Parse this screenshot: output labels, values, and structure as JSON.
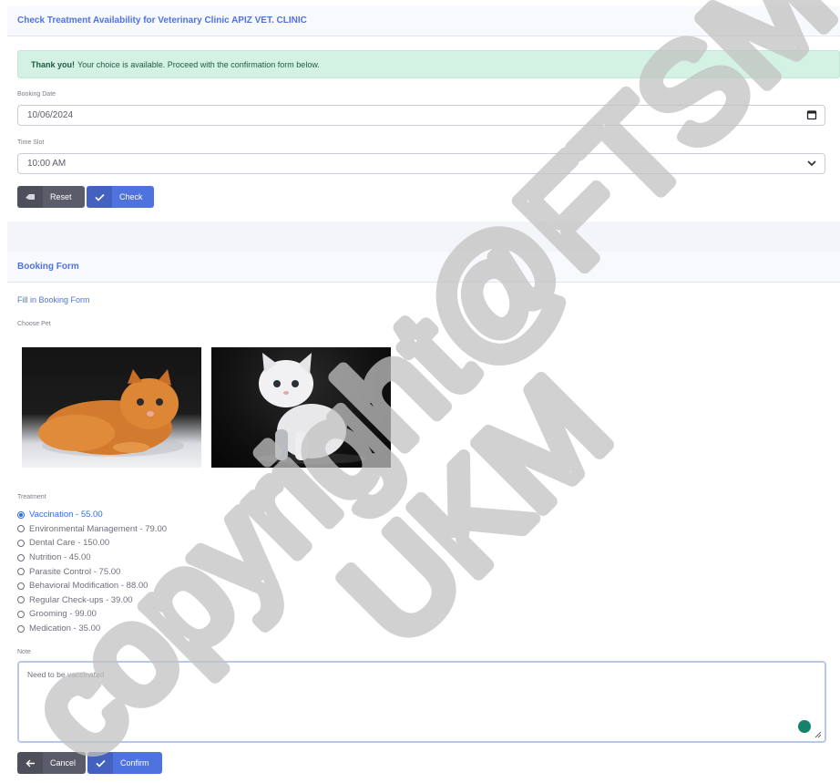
{
  "availability": {
    "header": "Check Treatment Availability for Veterinary Clinic APIZ VET. CLINIC",
    "alert_bold": "Thank you!",
    "alert_text": "Your choice is available. Proceed with the confirmation form below.",
    "date_label": "Booking Date",
    "date_value": "10/06/2024",
    "time_label": "Time Slot",
    "time_value": "10:00 AM",
    "reset_label": "Reset",
    "check_label": "Check"
  },
  "booking": {
    "header": "Booking Form",
    "subtitle": "Fill in Booking Form",
    "pet_label": "Choose Pet",
    "pets": [
      "orange-cat-photo",
      "white-kitten-photo"
    ],
    "treatment_label": "Treatment",
    "treatments": [
      "Vaccination - 55.00",
      "Environmental Management - 79.00",
      "Dental Care - 150.00",
      "Nutrition - 45.00",
      "Parasite Control - 75.00",
      "Behavioral Modification - 88.00",
      "Regular Check-ups - 39.00",
      "Grooming - 99.00",
      "Medication - 35.00"
    ],
    "selected_treatment_index": 0,
    "note_label": "Note",
    "note_value": "Need to be vaccinated",
    "cancel_label": "Cancel",
    "confirm_label": "Confirm"
  },
  "colors": {
    "primary": "#4e73df",
    "secondary": "#5a5c69",
    "success_bg": "#d4f2e4"
  },
  "watermark": {
    "line1": "copyright@FTSM",
    "line2": "UKM"
  }
}
